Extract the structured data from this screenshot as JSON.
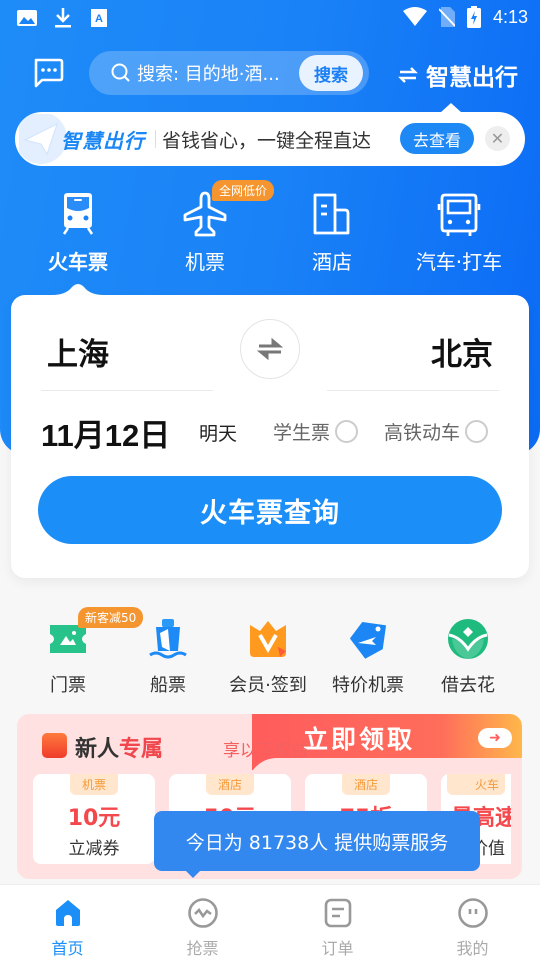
{
  "status_bar": {
    "left_icons": [
      "image-icon",
      "download-icon",
      "font-icon"
    ],
    "right_icons": [
      "wifi-icon",
      "no-sim-icon",
      "battery-charging-icon"
    ],
    "time": "4:13"
  },
  "top_bar": {
    "message_icon": "message-icon",
    "search": {
      "placeholder": "搜索: 目的地·酒...",
      "button_label": "搜索"
    },
    "smart_travel_link": "智慧出行"
  },
  "banner": {
    "brand": "智慧出行",
    "text": "省钱省心，一键全程直达",
    "button_label": "去查看",
    "close_icon": "close-icon"
  },
  "categories": [
    {
      "label": "火车票",
      "icon": "train-icon",
      "active": true
    },
    {
      "label": "机票",
      "icon": "airplane-icon",
      "badge": "全网低价"
    },
    {
      "label": "酒店",
      "icon": "hotel-icon"
    },
    {
      "label": "汽车·打车",
      "icon": "bus-icon"
    }
  ],
  "search_card": {
    "from_city": "上海",
    "to_city": "北京",
    "date": "11月12日",
    "date_relative": "明天",
    "options": [
      {
        "label": "学生票",
        "checked": false
      },
      {
        "label": "高铁动车",
        "checked": false
      }
    ],
    "query_button": "火车票查询"
  },
  "services": [
    {
      "label": "门票",
      "icon": "ticket-icon",
      "badge": "新客减50"
    },
    {
      "label": "船票",
      "icon": "ship-icon"
    },
    {
      "label": "会员·签到",
      "icon": "vip-crown-icon"
    },
    {
      "label": "特价机票",
      "icon": "flight-tag-icon"
    },
    {
      "label": "借去花",
      "icon": "sprout-icon"
    }
  ],
  "promo": {
    "title_part1": "新人",
    "title_part2": "专属",
    "subtitle": "享以下权益",
    "claim_label": "立即领取",
    "coupons": [
      {
        "tag": "机票",
        "amount": "10元",
        "desc": "立减券"
      },
      {
        "tag": "酒店",
        "amount": "50元",
        "desc": ""
      },
      {
        "tag": "酒店",
        "amount": "75折",
        "desc": ""
      },
      {
        "tag": "火车",
        "amount": "最高速",
        "desc": "价值"
      }
    ]
  },
  "tooltip": {
    "text": "今日为 81738人 提供购票服务"
  },
  "bottom_nav": [
    {
      "label": "首页",
      "icon": "home-icon",
      "active": true
    },
    {
      "label": "抢票",
      "icon": "pulse-icon"
    },
    {
      "label": "订单",
      "icon": "order-icon"
    },
    {
      "label": "我的",
      "icon": "profile-icon"
    }
  ],
  "colors": {
    "brand_blue": "#1b8ff7",
    "badge_orange": "#f5952f",
    "promo_red": "#f5484c",
    "promo_bg": "#ffe1e1"
  }
}
